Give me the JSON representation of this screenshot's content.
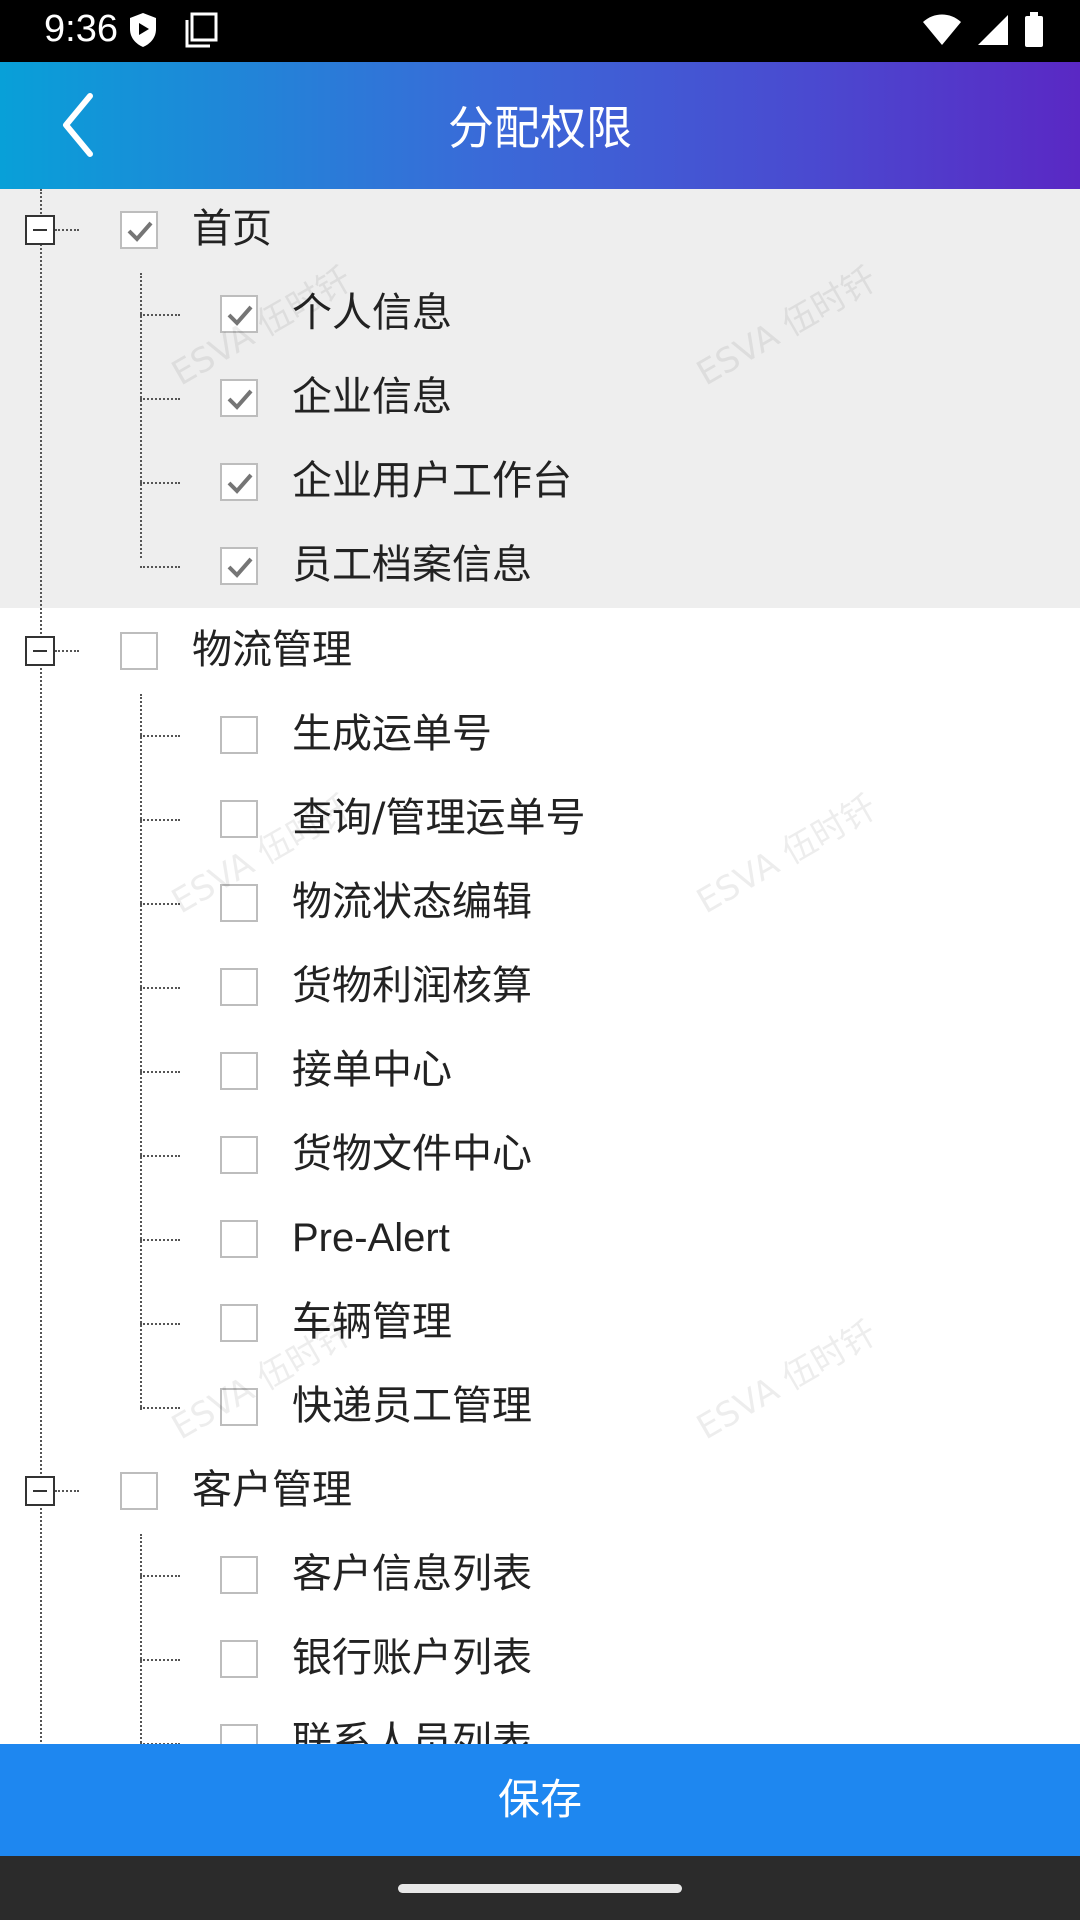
{
  "status_bar": {
    "time": "9:36"
  },
  "app_bar": {
    "title": "分配权限"
  },
  "watermark": {
    "text": "ESVA 伍时钎"
  },
  "tree": [
    {
      "label": "首页",
      "checked": true,
      "children": [
        {
          "label": "个人信息",
          "checked": true
        },
        {
          "label": "企业信息",
          "checked": true
        },
        {
          "label": "企业用户工作台",
          "checked": true
        },
        {
          "label": "员工档案信息",
          "checked": true
        }
      ]
    },
    {
      "label": "物流管理",
      "checked": false,
      "children": [
        {
          "label": "生成运单号",
          "checked": false
        },
        {
          "label": "查询/管理运单号",
          "checked": false
        },
        {
          "label": "物流状态编辑",
          "checked": false
        },
        {
          "label": "货物利润核算",
          "checked": false
        },
        {
          "label": "接单中心",
          "checked": false
        },
        {
          "label": "货物文件中心",
          "checked": false
        },
        {
          "label": "Pre-Alert",
          "checked": false
        },
        {
          "label": "车辆管理",
          "checked": false
        },
        {
          "label": "快递员工管理",
          "checked": false
        }
      ]
    },
    {
      "label": "客户管理",
      "checked": false,
      "children": [
        {
          "label": "客户信息列表",
          "checked": false
        },
        {
          "label": "银行账户列表",
          "checked": false
        },
        {
          "label": "联系人员列表",
          "checked": false
        }
      ]
    }
  ],
  "footer": {
    "save_label": "保存"
  }
}
